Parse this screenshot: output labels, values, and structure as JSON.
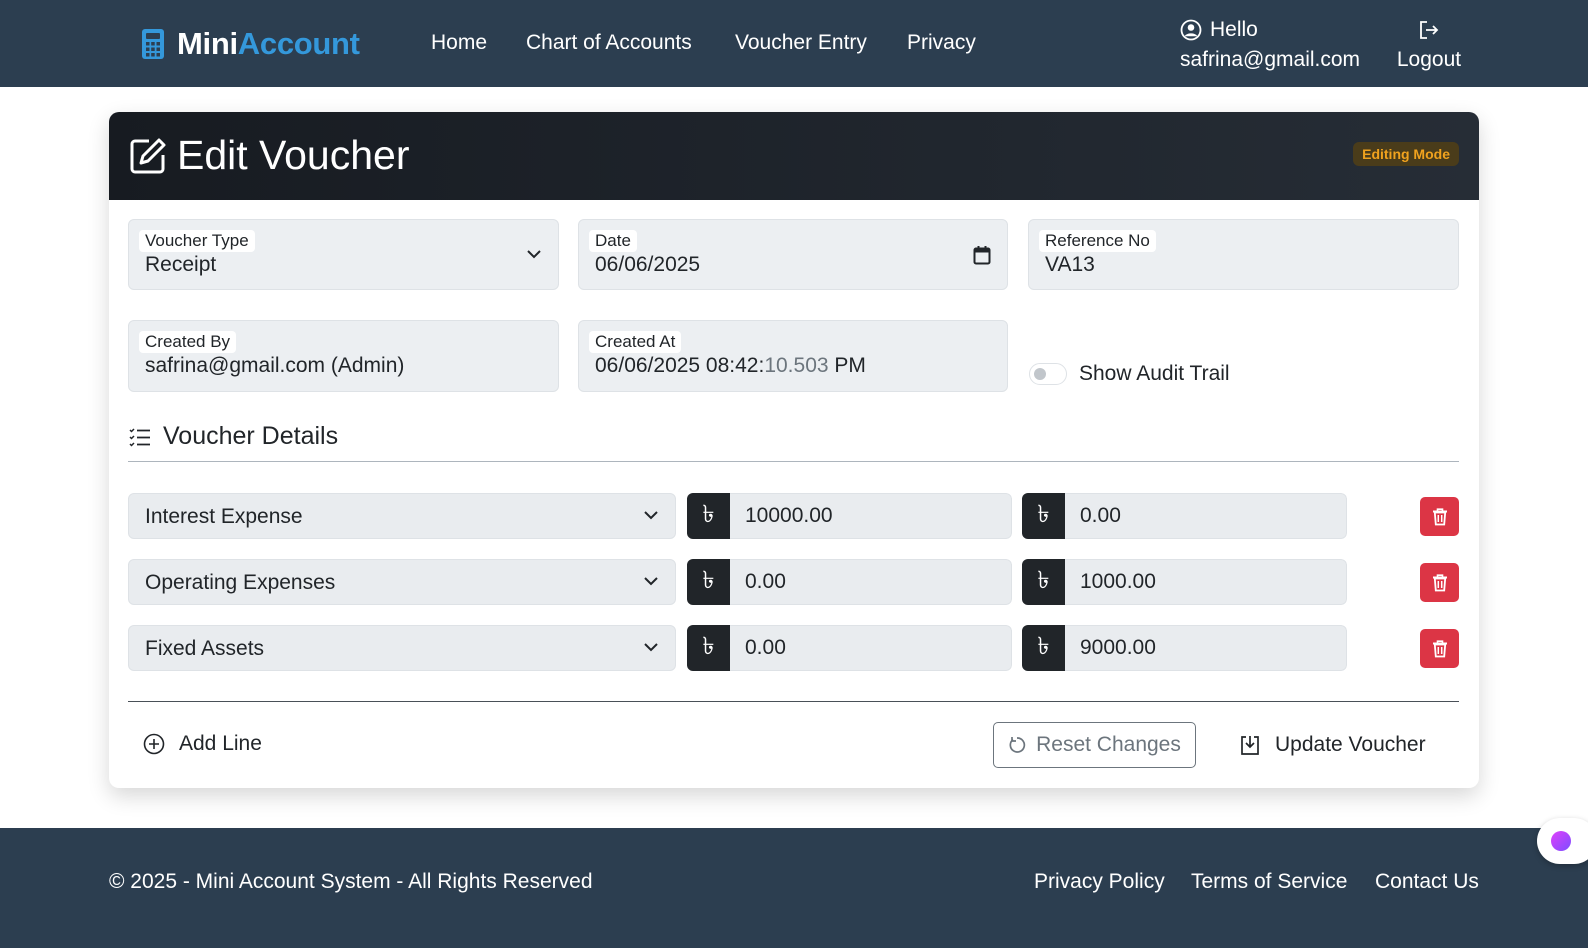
{
  "navbar": {
    "brand_part1": "Mini",
    "brand_part2": "Account",
    "links": [
      "Home",
      "Chart of Accounts",
      "Voucher Entry",
      "Privacy"
    ],
    "user_greeting": "Hello",
    "user_email": "safrina@gmail.com",
    "logout_label": "Logout",
    "icons": {
      "brand": "calculator-icon",
      "user": "user-circle-icon",
      "logout": "logout-icon"
    }
  },
  "card": {
    "title": "Edit Voucher",
    "badge": "Editing Mode",
    "fields": {
      "voucher_type": {
        "label": "Voucher Type",
        "value": "Receipt"
      },
      "date": {
        "label": "Date",
        "value": "06/06/2025"
      },
      "reference_no": {
        "label": "Reference No",
        "value": "VA13"
      },
      "created_by": {
        "label": "Created By",
        "value": "safrina@gmail.com (Admin)"
      },
      "created_at": {
        "label": "Created At",
        "value_main": "06/06/2025 08:42:",
        "value_ms": "10.503",
        "value_ampm": "PM"
      }
    },
    "audit_toggle_label": "Show Audit Trail",
    "details_title": "Voucher Details",
    "currency_symbol": "৳",
    "lines": [
      {
        "account": "Interest Expense",
        "debit": "10000.00",
        "credit": "0.00"
      },
      {
        "account": "Operating Expenses",
        "debit": "0.00",
        "credit": "1000.00"
      },
      {
        "account": "Fixed Assets",
        "debit": "0.00",
        "credit": "9000.00"
      }
    ],
    "add_line_label": "Add Line",
    "reset_label": "Reset Changes",
    "update_label": "Update Voucher"
  },
  "footer": {
    "copyright": "© 2025 - Mini Account System - All Rights Reserved",
    "links": [
      "Privacy Policy",
      "Terms of Service",
      "Contact Us"
    ]
  },
  "colors": {
    "navbar_bg": "#2c3e50",
    "brand_accent": "#3498db",
    "badge_text": "#f0a21e",
    "danger": "#dc3545"
  }
}
